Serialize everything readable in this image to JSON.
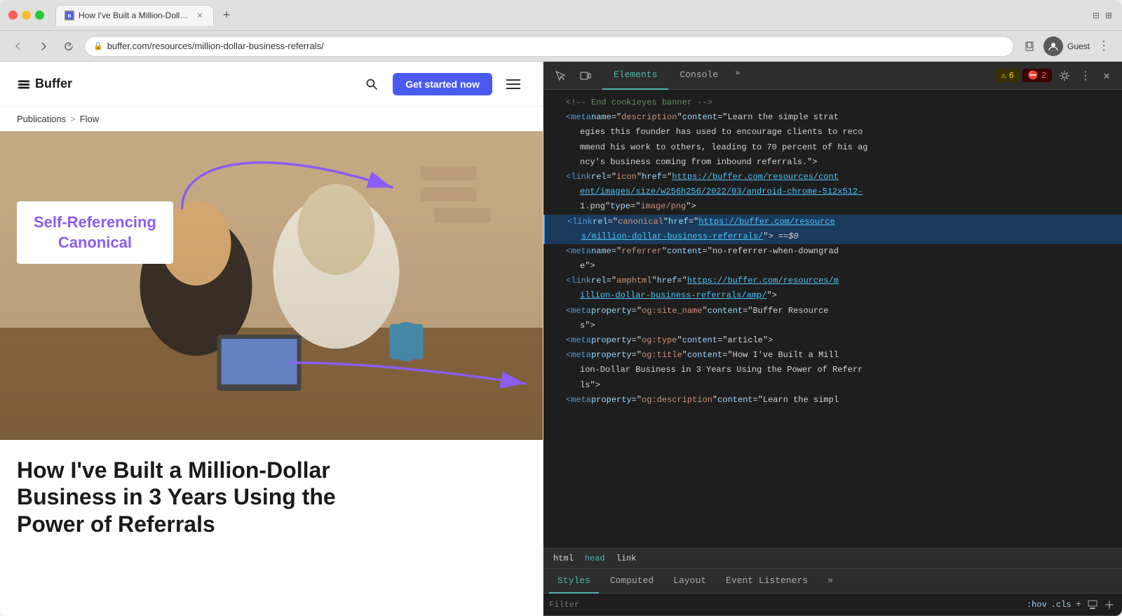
{
  "browser": {
    "tab_title": "How I've Built a Million-Dollar...",
    "tab_favicon": "B",
    "url": "buffer.com/resources/million-dollar-business-referrals/",
    "new_tab_label": "+",
    "back_btn": "‹",
    "forward_btn": "›",
    "refresh_btn": "↻",
    "account_label": "Guest"
  },
  "website": {
    "logo_text": "Buffer",
    "get_started_btn": "Get started now",
    "breadcrumb_parent": "Publications",
    "breadcrumb_sep": ">",
    "breadcrumb_current": "Flow",
    "annotation_label": "Self-Referencing\nCanonical",
    "article_title": "How I've Built a Million-Dollar\nBusiness in 3 Years Using the\nPower of Referrals"
  },
  "devtools": {
    "elements_tab": "Elements",
    "console_tab": "Console",
    "more_tabs_label": "»",
    "warn_count": "6",
    "err_count": "2",
    "close_label": "×",
    "code_lines": [
      {
        "type": "comment",
        "content": "<!-- End cookieyes banner -->"
      },
      {
        "type": "tag",
        "indent": 1,
        "content": "<meta name=\"description\" content=\"Learn the simple strat"
      },
      {
        "type": "text",
        "indent": 1,
        "content": "egies this founder has used to encourage clients to reco"
      },
      {
        "type": "text",
        "indent": 1,
        "content": "mmend his work to others, leading to 70 percent of his ag"
      },
      {
        "type": "text",
        "indent": 1,
        "content": "ncy's business coming from inbound referrals.\">"
      },
      {
        "type": "link_tag",
        "indent": 1,
        "prefix": "<link rel=\"icon\" href=\"",
        "link": "https://buffer.com/resources/cont",
        "suffix": ""
      },
      {
        "type": "text",
        "indent": 2,
        "content": "ent/images/size/w256h256/2022/03/android-chrome-512x512-"
      },
      {
        "type": "text",
        "indent": 2,
        "content": "1.png\" type=\"image/png\">"
      },
      {
        "type": "canonical",
        "content": "<link rel=\"canonical\" href=\"",
        "link": "https://buffer.com/resource",
        "link2": "s/million-dollar-business-referrals/",
        "suffix": "\"> == $0"
      },
      {
        "type": "tag",
        "indent": 1,
        "content": "<meta name=\"referrer\" content=\"no-referrer-when-downgrad"
      },
      {
        "type": "text",
        "indent": 1,
        "content": "e\">"
      },
      {
        "type": "link_tag",
        "indent": 1,
        "prefix": "<link rel=\"amphtml\" href=\"",
        "link": "https://buffer.com/resources/m",
        "suffix": ""
      },
      {
        "type": "text",
        "indent": 2,
        "content": "illion-dollar-business-referrals/amp/\">"
      },
      {
        "type": "tag",
        "indent": 1,
        "content": "<meta property=\"og:site_name\" content=\"Buffer Resource"
      },
      {
        "type": "text",
        "indent": 1,
        "content": "s\">"
      },
      {
        "type": "tag",
        "indent": 1,
        "content": "<meta property=\"og:type\" content=\"article\">"
      },
      {
        "type": "tag",
        "indent": 1,
        "content": "<meta property=\"og:title\" content=\"How I've Built a Mill"
      },
      {
        "type": "text",
        "indent": 1,
        "content": "ion-Dollar Business in 3 Years Using the Power of Referr"
      },
      {
        "type": "text",
        "indent": 1,
        "content": "ls\">"
      },
      {
        "type": "tag",
        "indent": 1,
        "content": "<meta property=\"og:description\" content=\"Learn the simpl"
      }
    ],
    "breadcrumb_items": [
      "html",
      "head",
      "link"
    ],
    "lower_tabs": [
      "Styles",
      "Computed",
      "Layout",
      "Event Listeners",
      "»"
    ],
    "filter_placeholder": "Filter",
    "filter_options": [
      ":hov",
      ".cls"
    ],
    "filter_plus": "+",
    "styles_tab": "Styles"
  },
  "colors": {
    "accent_purple": "#8b5cf6",
    "get_started_blue": "#4a5af0",
    "canonical_highlight_bg": "#1a3a5c",
    "link_color": "#4fc3f7",
    "active_tab_color": "#4db6ac"
  }
}
